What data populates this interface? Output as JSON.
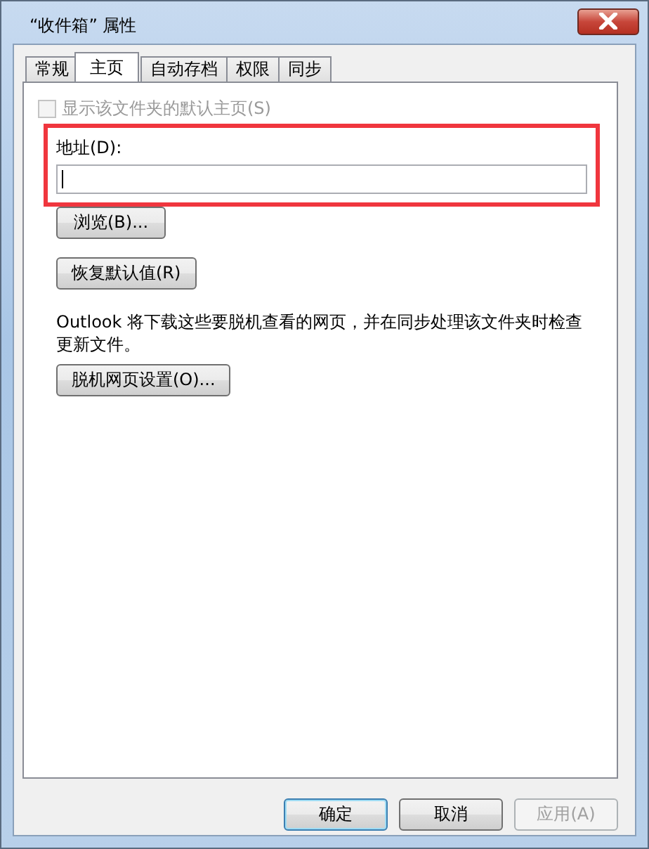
{
  "window": {
    "title": "“收件箱” 属性"
  },
  "tabs": [
    {
      "label": "常规",
      "selected": false
    },
    {
      "label": "主页",
      "selected": true
    },
    {
      "label": "自动存档",
      "selected": false
    },
    {
      "label": "权限",
      "selected": false
    },
    {
      "label": "同步",
      "selected": false
    }
  ],
  "home_page": {
    "show_default": {
      "label": "显示该文件夹的默认主页(S)",
      "checked": false,
      "disabled": true
    },
    "address": {
      "label": "地址(D):",
      "highlighted": true
    },
    "browse_button": "浏览(B)...",
    "restore_button": "恢复默认值(R)",
    "offline_note": "Outlook 将下载这些要脱机查看的网页，并在同步处理该文件夹时检查更新文件。",
    "offline_button": "脱机网页设置(O)..."
  },
  "buttons": [
    {
      "label": "确定",
      "default": true,
      "disabled": false
    },
    {
      "label": "取消",
      "default": false,
      "disabled": false
    },
    {
      "label": "应用(A)",
      "default": false,
      "disabled": true
    }
  ]
}
